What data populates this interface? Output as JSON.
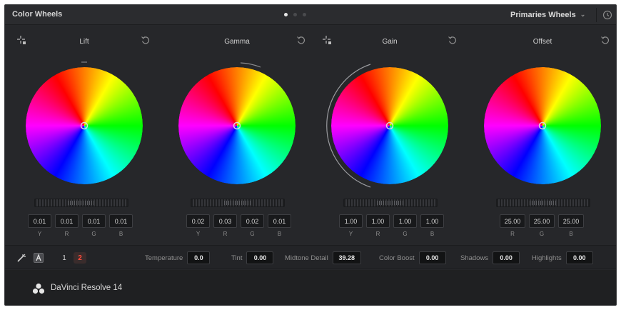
{
  "app": {
    "panel_title": "Color Wheels",
    "mode": "Primaries Wheels",
    "pages": 3,
    "current_page": 1
  },
  "wheels": [
    {
      "id": "lift",
      "label": "Lift",
      "values": [
        "0.01",
        "0.01",
        "0.01",
        "0.01"
      ],
      "channels": [
        "Y",
        "R",
        "G",
        "B"
      ],
      "has_picker": true
    },
    {
      "id": "gamma",
      "label": "Gamma",
      "values": [
        "0.02",
        "0.03",
        "0.02",
        "0.01"
      ],
      "channels": [
        "Y",
        "R",
        "G",
        "B"
      ],
      "has_picker": false
    },
    {
      "id": "gain",
      "label": "Gain",
      "values": [
        "1.00",
        "1.00",
        "1.00",
        "1.00"
      ],
      "channels": [
        "Y",
        "R",
        "G",
        "B"
      ],
      "has_picker": true
    },
    {
      "id": "offset",
      "label": "Offset",
      "values": [
        "25.00",
        "25.00",
        "25.00"
      ],
      "channels": [
        "R",
        "G",
        "B"
      ],
      "has_picker": false
    }
  ],
  "controls": {
    "page_buttons": [
      "1",
      "2"
    ],
    "params": [
      {
        "label": "Temperature",
        "value": "0.0"
      },
      {
        "label": "Tint",
        "value": "0.00"
      },
      {
        "label": "Midtone Detail",
        "value": "39.28"
      },
      {
        "label": "Color Boost",
        "value": "0.00"
      },
      {
        "label": "Shadows",
        "value": "0.00"
      },
      {
        "label": "Highlights",
        "value": "0.00"
      }
    ]
  },
  "footer": {
    "brand": "DaVinci Resolve 14"
  },
  "icons": {
    "picker": "eyedropper-crosshair-icon",
    "reset": "reset-icon",
    "history": "history-icon",
    "auto_balance": "auto-balance-icon",
    "auto": "auto-a-icon",
    "logo": "davinci-logo-icon"
  },
  "colors": {
    "accent_red": "#ff4a3a",
    "background": "#26272a"
  }
}
